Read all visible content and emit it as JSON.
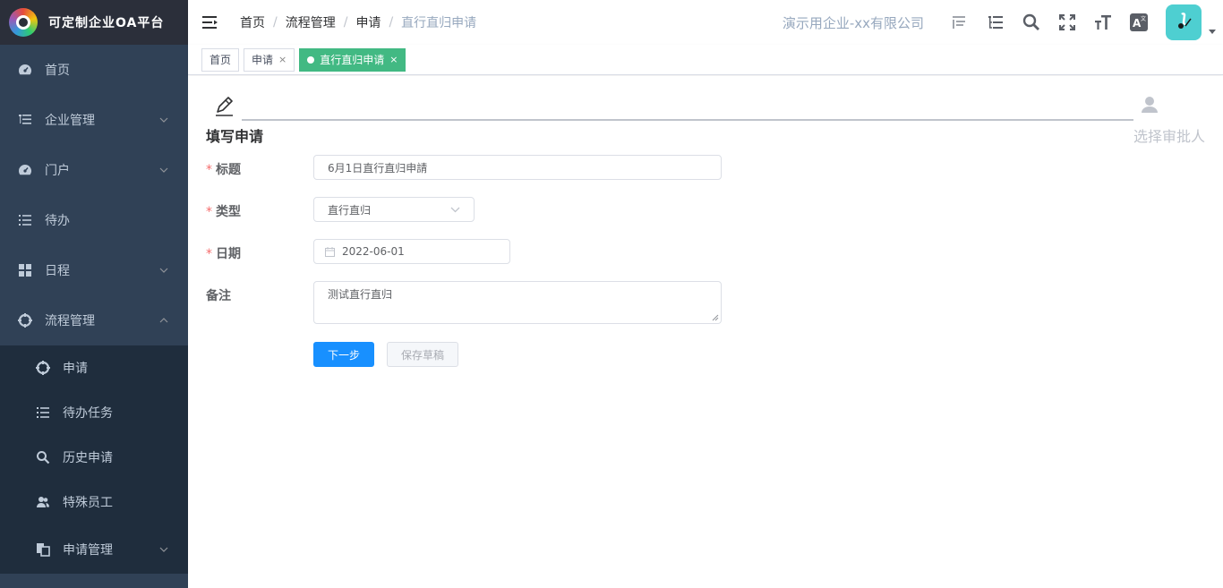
{
  "app": {
    "title": "可定制企业OA平台"
  },
  "sidebar": {
    "items": [
      {
        "label": "首页",
        "icon": "dashboard-icon"
      },
      {
        "label": "企业管理",
        "icon": "tree-list-icon"
      },
      {
        "label": "门户",
        "icon": "dashboard-icon"
      },
      {
        "label": "待办",
        "icon": "list-icon"
      },
      {
        "label": "日程",
        "icon": "grid-icon"
      },
      {
        "label": "流程管理",
        "icon": "target-icon",
        "expanded": true
      }
    ],
    "submenu": [
      {
        "label": "申请",
        "icon": "target-icon"
      },
      {
        "label": "待办任务",
        "icon": "list-icon"
      },
      {
        "label": "历史申请",
        "icon": "search-icon"
      },
      {
        "label": "特殊员工",
        "icon": "users-icon"
      },
      {
        "label": "申请管理",
        "icon": "copy-icon"
      }
    ]
  },
  "header": {
    "breadcrumb": [
      "首页",
      "流程管理",
      "申请",
      "直行直归申请"
    ],
    "company": "演示用企业-xx有限公司",
    "icons": [
      "layout-icon",
      "tree-list-icon",
      "search-icon",
      "fullscreen-icon",
      "font-size-icon",
      "translate-icon"
    ]
  },
  "tags": [
    {
      "label": "首页",
      "closable": false,
      "active": false
    },
    {
      "label": "申请",
      "closable": true,
      "active": false
    },
    {
      "label": "直行直归申请",
      "closable": true,
      "active": true
    }
  ],
  "steps": {
    "step1": "填写申请",
    "step2": "选择审批人"
  },
  "form": {
    "title_label": "标题",
    "title_value": "6月1日直行直归申請",
    "type_label": "类型",
    "type_value": "直行直归",
    "date_label": "日期",
    "date_value": "2022-06-01",
    "remark_label": "备注",
    "remark_value": "测试直行直归",
    "next_button": "下一步",
    "draft_button": "保存草稿"
  },
  "colors": {
    "sidebar": "#304156",
    "submenu": "#1f2d3d",
    "primary": "#1890ff",
    "active_tag": "#42b983"
  }
}
